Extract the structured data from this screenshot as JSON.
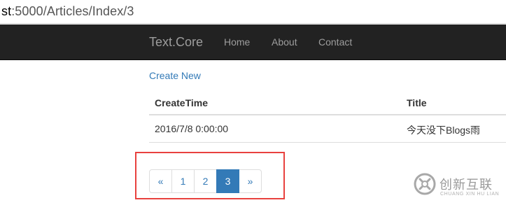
{
  "browser": {
    "url_host_fragment": "st",
    "url_rest": ":5000/Articles/Index/3"
  },
  "navbar": {
    "brand": "Text.Core",
    "links": [
      "Home",
      "About",
      "Contact"
    ]
  },
  "content": {
    "create_new": "Create New",
    "table": {
      "headers": [
        "CreateTime",
        "Title"
      ],
      "rows": [
        [
          "2016/7/8 0:00:00",
          "今天没下Blogs雨"
        ]
      ]
    },
    "pagination": {
      "items": [
        "«",
        "1",
        "2",
        "3",
        "»"
      ],
      "active": "3"
    }
  },
  "watermark": {
    "cn": "创新互联",
    "en": "CHUANG XIN HU LIAN"
  },
  "colors": {
    "navbar_bg": "#222222",
    "nav_text": "#9d9d9d",
    "link": "#337ab7",
    "highlight_border": "#e8413e"
  }
}
